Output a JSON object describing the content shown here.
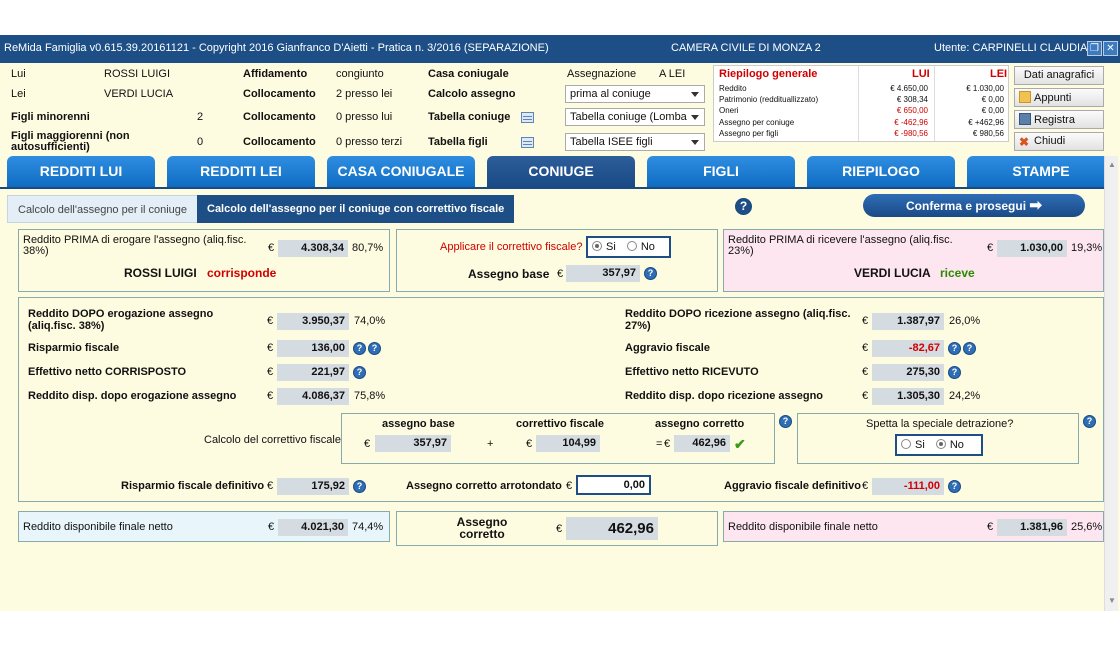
{
  "titlebar": {
    "left": "ReMida Famiglia v0.615.39.20161121 - Copyright 2016 Gianfranco D'Aietti - Pratica n. 3/2016 (SEPARAZIONE)",
    "center": "CAMERA CIVILE DI MONZA 2",
    "right": "Utente: CARPINELLI CLAUDIA"
  },
  "header": {
    "lui_label": "Lui",
    "lui_value": "ROSSI LUIGI",
    "lei_label": "Lei",
    "lei_value": "VERDI LUCIA",
    "minori_label": "Figli minorenni",
    "minori_value": "2",
    "maggiori_label": "Figli maggiorenni (non autosufficienti)",
    "maggiori_value": "0",
    "affidamento_label": "Affidamento",
    "affidamento_value": "congiunto",
    "collocamento_label": "Collocamento",
    "coll1": "2 presso lei",
    "coll2": "0 presso lui",
    "coll3": "0 presso terzi",
    "casa_label": "Casa coniugale",
    "assegnazione_label": "Assegnazione",
    "assegnazione_value": "A LEI",
    "calcolo_label": "Calcolo assegno",
    "calcolo_value": "prima al coniuge",
    "tab_coniuge_label": "Tabella coniuge",
    "tab_coniuge_value": "Tabella coniuge (Lomba",
    "tab_figli_label": "Tabella figli",
    "tab_figli_value": "Tabella ISEE figli"
  },
  "summary": {
    "title": "Riepilogo generale",
    "col_lui": "LUI",
    "col_lei": "LEI",
    "rows": [
      {
        "label": "Reddito",
        "lui": "€ 4.650,00",
        "lei": "€ 1.030,00"
      },
      {
        "label": "Patrimonio (reddituallizzato)",
        "lui": "€ 308,34",
        "lei": "€ 0,00"
      },
      {
        "label": "Oneri",
        "lui": "€ 650,00",
        "lei": "€ 0,00"
      },
      {
        "label": "Assegno per coniuge",
        "lui": "€ -462,96",
        "lei": "€ +462,96"
      },
      {
        "label": "Assegno per figli",
        "lui": "€ -980,56",
        "lei": "€ 980,56"
      }
    ]
  },
  "sidebar": {
    "dati": "Dati anagrafici",
    "appunti": "Appunti",
    "registra": "Registra",
    "chiudi": "Chiudi"
  },
  "tabs": [
    "REDDITI LUI",
    "REDDITI LEI",
    "CASA CONIUGALE",
    "CONIUGE",
    "FIGLI",
    "RIEPILOGO",
    "STAMPE"
  ],
  "subtabs": {
    "first": "Calcolo dell'assegno per il coniuge",
    "second": "Calcolo dell'assegno per il coniuge con correttivo fiscale"
  },
  "confirm": "Conferma e prosegui",
  "euro": "€",
  "top": {
    "left_label": "Reddito PRIMA di erogare l'assegno (aliq.fisc. 38%)",
    "left_value": "4.308,34",
    "left_pct": "80,7%",
    "left_name": "ROSSI LUIGI",
    "left_verb": "corrisponde",
    "mid_question": "Applicare il correttivo fiscale?",
    "si": "Si",
    "no": "No",
    "base_label": "Assegno base",
    "base_value": "357,97",
    "right_label": "Reddito PRIMA di ricevere l'assegno (aliq.fisc. 23%)",
    "right_value": "1.030,00",
    "right_pct": "19,3%",
    "right_name": "VERDI LUCIA",
    "right_verb": "riceve"
  },
  "main": {
    "l1_label": "Reddito DOPO erogazione assegno (aliq.fisc. 38%)",
    "l1_value": "3.950,37",
    "l1_pct": "74,0%",
    "l2_label": "Risparmio fiscale",
    "l2_value": "136,00",
    "l3_label": "Effettivo netto CORRISPOSTO",
    "l3_value": "221,97",
    "l4_label": "Reddito disp. dopo erogazione assegno",
    "l4_value": "4.086,37",
    "l4_pct": "75,8%",
    "r1_label": "Reddito DOPO ricezione assegno (aliq.fisc. 27%)",
    "r1_value": "1.387,97",
    "r1_pct": "26,0%",
    "r2_label": "Aggravio fiscale",
    "r2_value": "-82,67",
    "r3_label": "Effettivo netto RICEVUTO",
    "r3_value": "275,30",
    "r4_label": "Reddito disp. dopo ricezione assegno",
    "r4_value": "1.305,30",
    "r4_pct": "24,2%",
    "corr_label": "Calcolo del correttivo fiscale",
    "h_base": "assegno base",
    "h_corr": "correttivo fiscale",
    "h_assegno": "assegno corretto",
    "v_base": "357,97",
    "plus": "+",
    "v_corr": "104,99",
    "eq": "=",
    "v_assegno": "462,96",
    "detr_question": "Spetta la speciale detrazione?",
    "risp_def_label": "Risparmio fiscale definitivo",
    "risp_def_value": "175,92",
    "arr_label": "Assegno corretto arrotondato",
    "arr_value": "0,00",
    "aggr_def_label": "Aggravio fiscale definitivo",
    "aggr_def_value": "-111,00"
  },
  "bottom": {
    "left_label": "Reddito disponibile finale netto",
    "left_value": "4.021,30",
    "left_pct": "74,4%",
    "mid_label": "Assegno corretto",
    "mid_value": "462,96",
    "right_label": "Reddito disponibile finale netto",
    "right_value": "1.381,96",
    "right_pct": "25,6%"
  }
}
